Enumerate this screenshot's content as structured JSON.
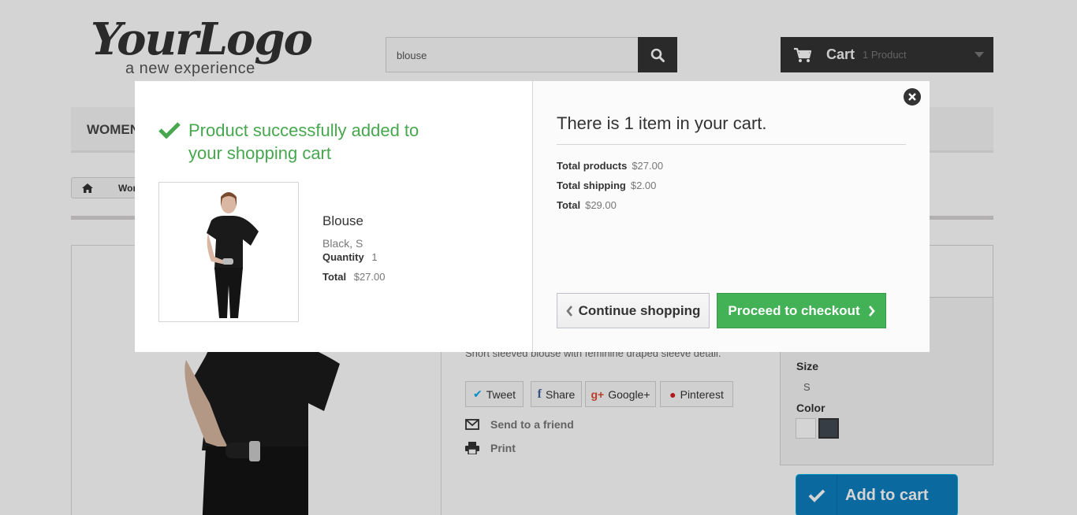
{
  "header": {
    "logo_main": "YourLogo",
    "logo_sub": "a new experience",
    "search_value": "blouse",
    "cart_label": "Cart",
    "cart_count": "1 Product"
  },
  "menu": {
    "item": "WOMEN"
  },
  "breadcrumb": {
    "current": "Women"
  },
  "product_page": {
    "description": "Short sleeved blouse with feminine draped sleeve detail.",
    "social": {
      "tweet": "Tweet",
      "share": "Share",
      "google": "Google+",
      "pinterest": "Pinterest"
    },
    "send_friend": "Send to a friend",
    "print": "Print",
    "size_label": "Size",
    "size_value": "S",
    "color_label": "Color",
    "colors": [
      "#ffffff",
      "#434a54"
    ],
    "add_to_cart": "Add to cart"
  },
  "modal": {
    "success": "Product successfully added to your shopping cart",
    "product": {
      "name": "Blouse",
      "attributes": "Black, S",
      "quantity_label": "Quantity",
      "quantity": "1",
      "total_label": "Total",
      "total": "$27.00"
    },
    "cart_summary": {
      "heading": "There is 1 item in your cart.",
      "total_products_label": "Total products",
      "total_products": "$27.00",
      "total_shipping_label": "Total shipping",
      "total_shipping": "$2.00",
      "total_label": "Total",
      "total": "$29.00"
    },
    "continue_label": "Continue shopping",
    "checkout_label": "Proceed to checkout"
  },
  "colors": {
    "success_green": "#46a74e",
    "checkout_green": "#43b155",
    "add_cart_blue": "#0d7fc0",
    "dark": "#333333"
  },
  "icons": [
    "search-icon",
    "cart-icon",
    "home-icon",
    "check-icon",
    "close-icon",
    "chevron-left-icon",
    "chevron-right-icon",
    "envelope-icon",
    "printer-icon"
  ]
}
